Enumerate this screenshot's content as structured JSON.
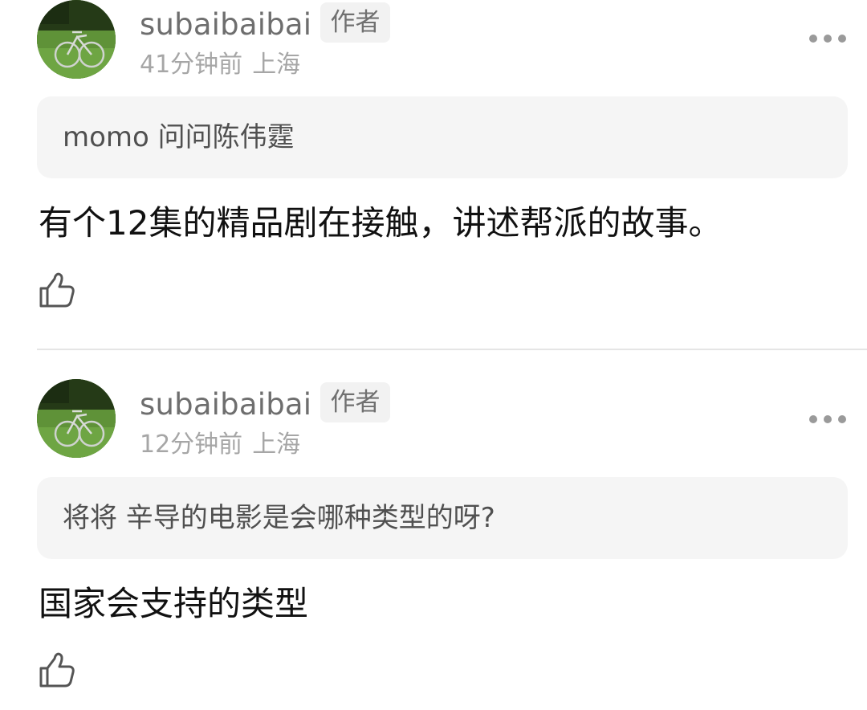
{
  "comments": [
    {
      "username": "subaibaibai",
      "badge": "作者",
      "time": "41分钟前",
      "location": "上海",
      "quote": "momo 问问陈伟霆",
      "text": "有个12集的精品剧在接触，讲述帮派的故事。"
    },
    {
      "username": "subaibaibai",
      "badge": "作者",
      "time": "12分钟前",
      "location": "上海",
      "quote": "将将 辛导的电影是会哪种类型的呀?",
      "text": "国家会支持的类型"
    }
  ],
  "icons": {
    "more": "more-horizontal-icon",
    "like": "thumbs-up-icon",
    "avatar": "bicycle-photo-avatar"
  },
  "colors": {
    "username": "#6e6e6e",
    "meta": "#a6a6a6",
    "quote_background": "#f5f5f5",
    "badge_background": "#f2f2f2",
    "text": "#111111"
  }
}
